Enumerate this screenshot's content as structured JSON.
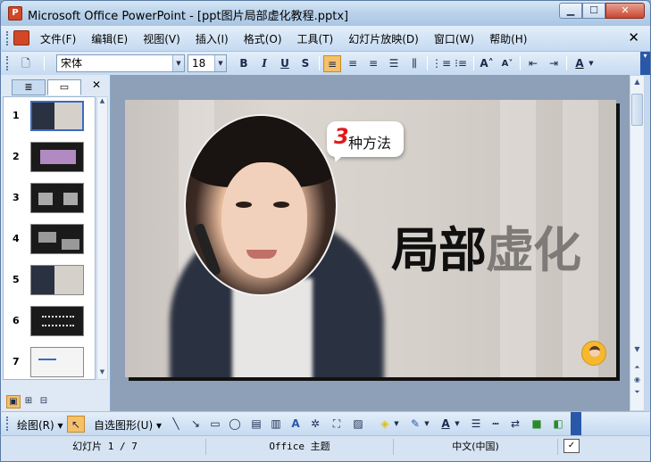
{
  "window": {
    "title": "Microsoft Office PowerPoint - [ppt图片局部虚化教程.pptx]",
    "app_icon": "powerpoint-icon",
    "minimize": "▁",
    "maximize": "☐",
    "close": "✕"
  },
  "menu": {
    "items": [
      "文件(F)",
      "编辑(E)",
      "视图(V)",
      "插入(I)",
      "格式(O)",
      "工具(T)",
      "幻灯片放映(D)",
      "窗口(W)",
      "帮助(H)"
    ],
    "close_doc": "✕"
  },
  "format_toolbar": {
    "font_name": "宋体",
    "font_size": "18",
    "bold": "B",
    "italic": "I",
    "underline": "U",
    "shadow": "S",
    "font_color_glyph": "A"
  },
  "left_pane": {
    "tab_outline": "≣",
    "tab_slides": "▭",
    "close": "✕",
    "slides": [
      {
        "num": "1",
        "style": "photo",
        "selected": true
      },
      {
        "num": "2",
        "style": "dark",
        "selected": false
      },
      {
        "num": "3",
        "style": "dark",
        "selected": false
      },
      {
        "num": "4",
        "style": "dark",
        "selected": false
      },
      {
        "num": "5",
        "style": "photo",
        "selected": false
      },
      {
        "num": "6",
        "style": "dark",
        "selected": false
      },
      {
        "num": "7",
        "style": "light",
        "selected": false
      }
    ]
  },
  "slide": {
    "bubble_number": "3",
    "bubble_text": "种方法",
    "title_dark": "局部",
    "title_grey": "虚化"
  },
  "draw_toolbar": {
    "draw_label": "绘图(R)",
    "autoshapes_label": "自选图形(U)"
  },
  "status": {
    "slide_info": "幻灯片 1 / 7",
    "theme": "Office 主题",
    "language": "中文(中国)"
  },
  "colors": {
    "title_bar": "#b9d2ea",
    "accent_orange": "#f6c06a",
    "bubble_number": "#e01a1a"
  }
}
